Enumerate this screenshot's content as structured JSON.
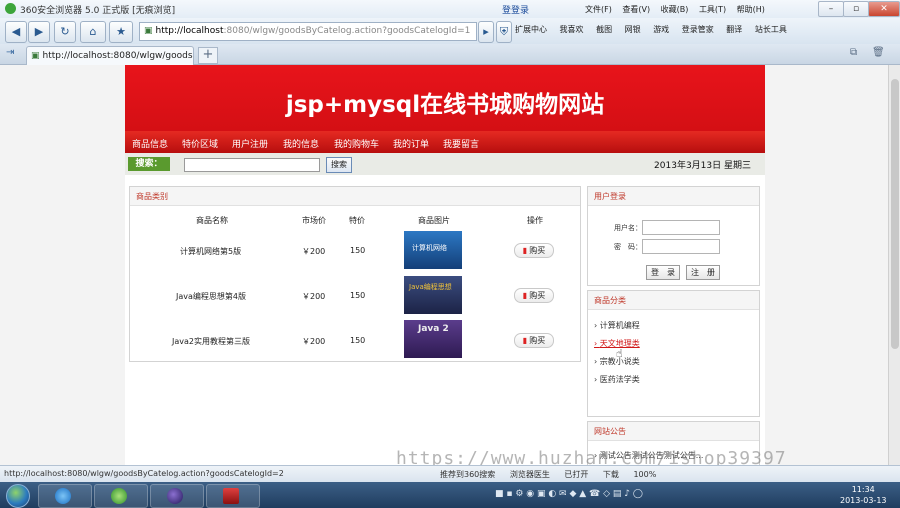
{
  "browser": {
    "title": "360安全浏览器 5.0 正式版 [无痕浏览]",
    "login_link": "登登录",
    "menus": [
      "文件(F)",
      "查看(V)",
      "收藏(B)",
      "工具(T)",
      "帮助(H)"
    ],
    "address_host": "http://localhost",
    "address_rest": ":8080/wlgw/goodsByCatelog.action?goodsCatelogId=1",
    "toolbar": [
      "扩展中心",
      "我喜欢",
      "截图",
      "网银",
      "游戏",
      "登录管家",
      "翻译",
      "站长工具"
    ],
    "tab_title": "http://localhost:8080/wlgw/goods...",
    "new_tab": "+"
  },
  "site": {
    "banner_title": "jsp+mysql在线书城购物网站",
    "nav": [
      "商品信息",
      "特价区域",
      "用户注册",
      "我的信息",
      "我的购物车",
      "我的订单",
      "我要留言"
    ],
    "search_label": "搜索：",
    "search_button": "搜索",
    "date": "2013年3月13日 星期三",
    "goods_panel": {
      "title": "商品类别",
      "headers": [
        "商品名称",
        "市场价",
        "特价",
        "商品图片",
        "操作"
      ],
      "rows": [
        {
          "name": "计算机网络第5版",
          "market_price": "￥200",
          "special_price": "150",
          "buy": "购买",
          "cover_color": "#1f5fa8"
        },
        {
          "name": "Java编程思想第4版",
          "market_price": "￥200",
          "special_price": "150",
          "buy": "购买",
          "cover_color": "#2b3a66"
        },
        {
          "name": "Java2实用教程第三版",
          "market_price": "￥200",
          "special_price": "150",
          "buy": "购买",
          "cover_color": "#3e2a6e"
        }
      ],
      "cover_labels": [
        "计算机网络",
        "Java编程思想",
        "Java 2"
      ]
    },
    "login_panel": {
      "title": "用户登录",
      "username_label": "用户名：",
      "password_label": "密　码：",
      "login_button": "登　录",
      "register_button": "注　册"
    },
    "category_panel": {
      "title": "商品分类",
      "items": [
        "计算机编程",
        "天文地理类",
        "宗教小说类",
        "医药法学类"
      ],
      "active_index": 1
    },
    "notice_panel": {
      "title": "网站公告",
      "items": [
        "测试公告测试公告测试公告..."
      ]
    }
  },
  "status": {
    "url": "http://localhost:8080/wlgw/goodsByCatelog.action?goodsCatelogId=2",
    "items": [
      "推荐到360搜索",
      "浏览器医生",
      "已打开",
      "下载",
      "100%"
    ]
  },
  "taskbar": {
    "time": "11:34",
    "date": "2013-03-13"
  },
  "watermark": "https://www.huzhan.com/ishop39397",
  "colors": {
    "banner_red": "#d40f14",
    "nav_red": "#c7140f",
    "search_green": "#5a9a2e",
    "panel_title": "#c0392b"
  }
}
